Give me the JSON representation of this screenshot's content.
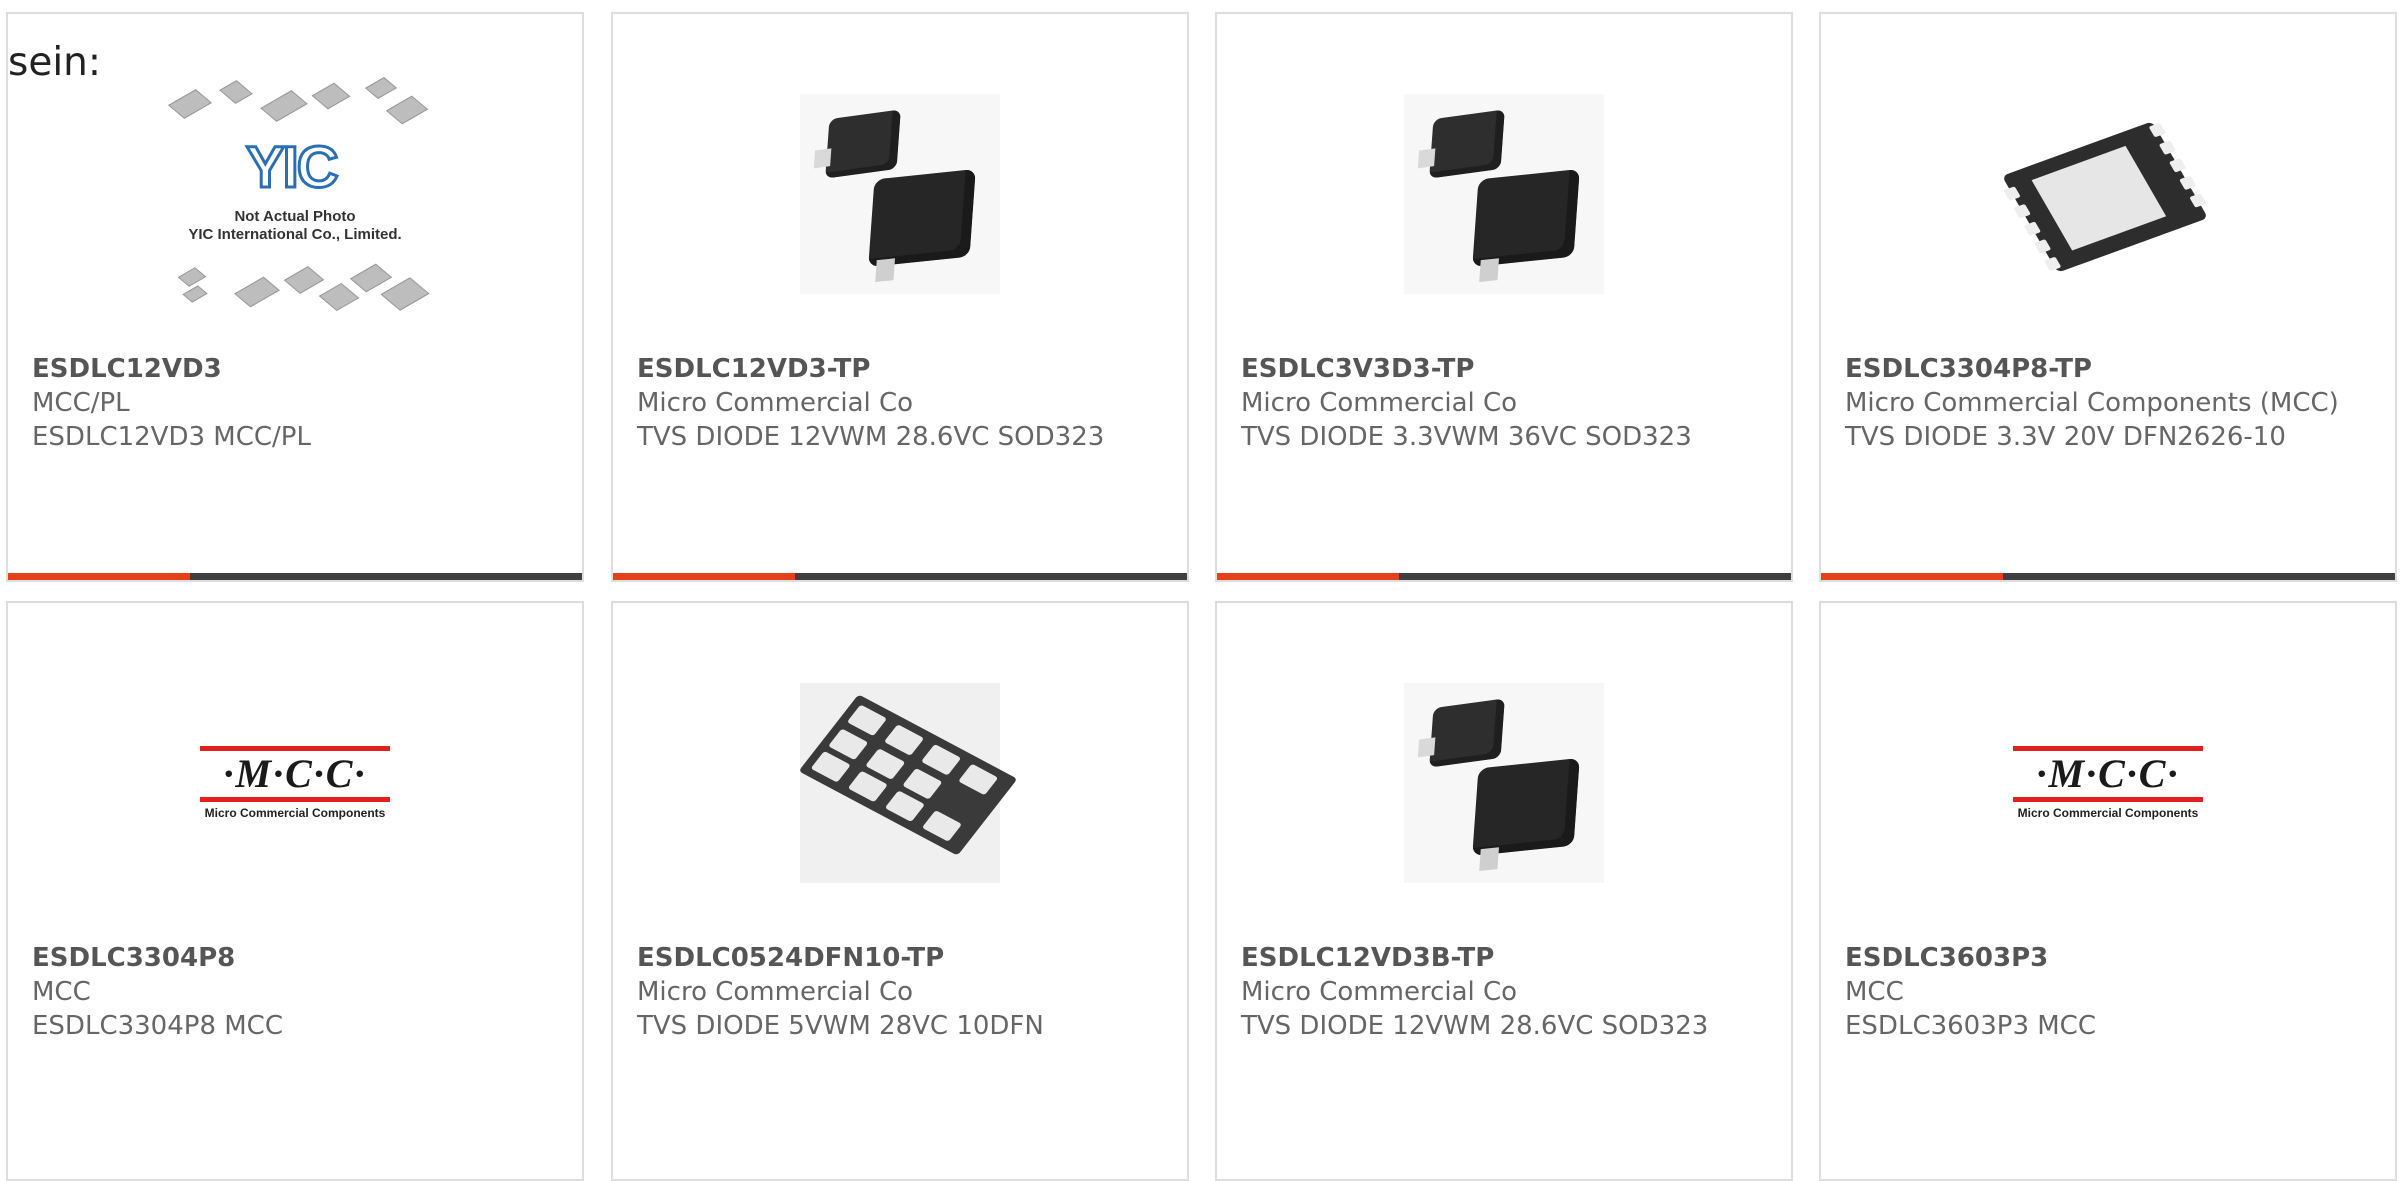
{
  "lead_text": "sein:",
  "colors": {
    "accent": "#e5401a",
    "bar": "#3f3f3f",
    "border": "#dddddd"
  },
  "products": [
    {
      "part": "ESDLC12VD3",
      "manufacturer": "MCC/PL",
      "description": "ESDLC12VD3 MCC/PL",
      "image": "yic-placeholder",
      "image_text": {
        "logo": "YIC",
        "note_line1": "Not Actual Photo",
        "note_line2": "YIC International Co., Limited."
      }
    },
    {
      "part": "ESDLC12VD3-TP",
      "manufacturer": "Micro Commercial Co",
      "description": "TVS DIODE 12VWM 28.6VC SOD323",
      "image": "sod323-package"
    },
    {
      "part": "ESDLC3V3D3-TP",
      "manufacturer": "Micro Commercial Co",
      "description": "TVS DIODE 3.3VWM 36VC SOD323",
      "image": "sod323-package"
    },
    {
      "part": "ESDLC3304P8-TP",
      "manufacturer": "Micro Commercial Components (MCC)",
      "description": "TVS DIODE 3.3V 20V DFN2626-10",
      "image": "dfn-package"
    },
    {
      "part": "ESDLC3304P8",
      "manufacturer": "MCC",
      "description": "ESDLC3304P8 MCC",
      "image": "mcc-logo",
      "image_text": {
        "logo": "·M·C·C·",
        "sub": "Micro Commercial Components"
      }
    },
    {
      "part": "ESDLC0524DFN10-TP",
      "manufacturer": "Micro Commercial Co",
      "description": "TVS DIODE 5VWM 28VC 10DFN",
      "image": "ulga-package"
    },
    {
      "part": "ESDLC12VD3B-TP",
      "manufacturer": "Micro Commercial Co",
      "description": "TVS DIODE 12VWM 28.6VC SOD323",
      "image": "sod323-package"
    },
    {
      "part": "ESDLC3603P3",
      "manufacturer": "MCC",
      "description": "ESDLC3603P3 MCC",
      "image": "mcc-logo",
      "image_text": {
        "logo": "·M·C·C·",
        "sub": "Micro Commercial Components"
      }
    }
  ]
}
